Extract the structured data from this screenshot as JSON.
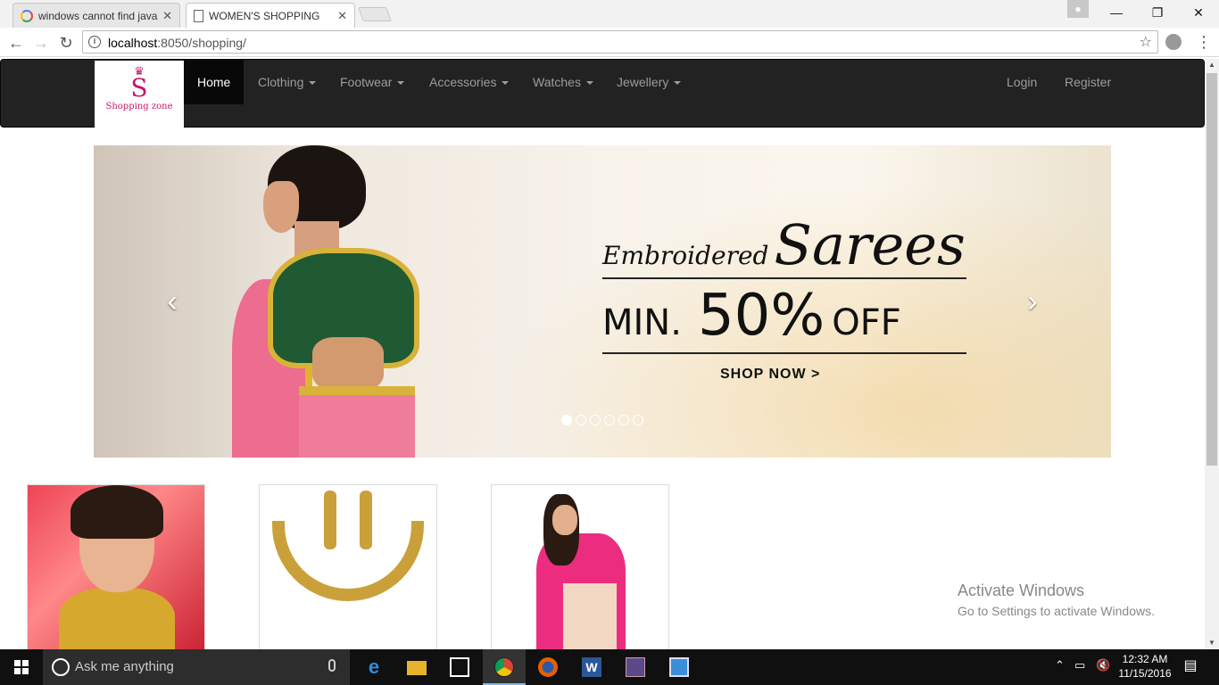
{
  "browser": {
    "tabs": [
      {
        "title": "windows cannot find java",
        "icon": "google-icon"
      },
      {
        "title": "WOMEN'S SHOPPING",
        "icon": "page-icon"
      }
    ],
    "url_host": "localhost",
    "url_path": ":8050/shopping/"
  },
  "site": {
    "brand_letter": "S",
    "brand_name": "Shopping zone",
    "nav": {
      "home": "Home",
      "clothing": "Clothing",
      "footwear": "Footwear",
      "accessories": "Accessories",
      "watches": "Watches",
      "jewellery": "Jewellery",
      "login": "Login",
      "register": "Register"
    },
    "carousel": {
      "line1_a": "Embroidered",
      "line1_b": "Sarees",
      "line2_a": "MIN.",
      "line2_b": "50%",
      "line2_c": "OFF",
      "cta": "SHOP NOW >",
      "slide_count": 6,
      "active_slide": 1
    }
  },
  "watermark": {
    "title": "Activate Windows",
    "subtitle": "Go to Settings to activate Windows."
  },
  "taskbar": {
    "search_placeholder": "Ask me anything",
    "time": "12:32 AM",
    "date": "11/15/2016"
  }
}
